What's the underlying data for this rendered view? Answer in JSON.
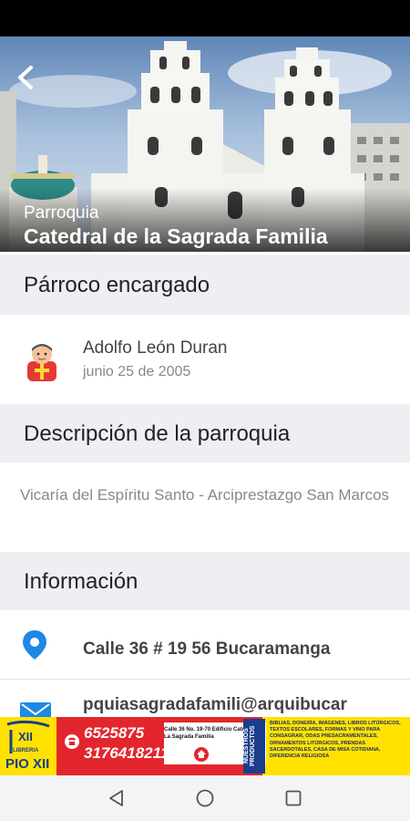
{
  "header": {
    "subtitle": "Parroquia",
    "title": "Catedral de la Sagrada Familia"
  },
  "sections": {
    "priest": "Párroco encargado",
    "description": "Descripción de la parroquia",
    "info": "Información"
  },
  "priest": {
    "name": "Adolfo León Duran",
    "date": "junio 25 de 2005"
  },
  "description": "Vicaría del Espíritu Santo - Arciprestazgo San Marcos",
  "info": {
    "address": "Calle 36 # 19 56 Bucaramanga",
    "email": "pquiasagradafamili@arquibucar"
  },
  "ad": {
    "brand_top": "XII",
    "brand_sub": "LIBRERIA",
    "brand_name": "PIO XII",
    "phone1": "6525875",
    "phone2": "3176418211",
    "address_line": "Calle 36 No. 19-70 Edificio Catedral La Sagrada Familia",
    "tag": "NUESTROS PRODUCTOS",
    "products": "BIBLIAS, DONERÍA, IMÁGENES, LIBROS LITÚRGICOS, TEXTOS ESCOLARES, FORMAS Y VINO PARA CONSAGRAR, ODAS PRESACRAMENTALES, ORNAMENTOS LITÚRGICOS, PRENDAS SACERDOTALES, CASA DE MISA COTIDIANA, DIFERENCIA RELIGIOSA"
  },
  "colors": {
    "accent": "#1e88e5",
    "section_bg": "#eeeef3",
    "ad_red": "#e3262d",
    "ad_yellow": "#ffe200"
  }
}
